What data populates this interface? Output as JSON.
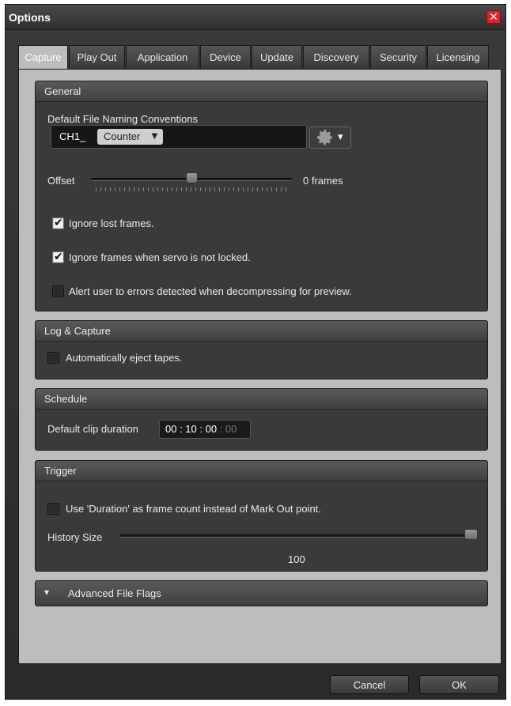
{
  "window": {
    "title": "Options",
    "close_glyph": "✕"
  },
  "tabs": [
    "Capture",
    "Play Out",
    "Application",
    "Device",
    "Update",
    "Discovery",
    "Security",
    "Licensing"
  ],
  "general": {
    "title": "General",
    "naming_label": "Default File Naming Conventions",
    "prefix": "CH1_",
    "token": "Counter",
    "token_arrow": "▼",
    "gear_arrow": "▾",
    "offset_label": "Offset",
    "offset_value": "0 frames",
    "offset_level": 0.5,
    "ignore_lost": {
      "label": "Ignore lost frames.",
      "checked": true
    },
    "ignore_servo": {
      "label": "Ignore frames when servo is not locked.",
      "checked": true
    },
    "alert_errors": {
      "label": "Alert user to errors detected when decompressing for preview.",
      "checked": false
    }
  },
  "log_capture": {
    "title": "Log & Capture",
    "eject": {
      "label": "Automatically eject tapes.",
      "checked": false
    }
  },
  "schedule": {
    "title": "Schedule",
    "duration_label": "Default clip duration",
    "duration_main": "00 : 10 : 00",
    "duration_frames": " : 00"
  },
  "trigger": {
    "title": "Trigger",
    "duration_count": {
      "label": "Use 'Duration' as frame count instead of Mark Out point.",
      "checked": false
    },
    "history_label": "History Size",
    "history_value": "100",
    "history_level": 1.0
  },
  "advanced": {
    "title": "Advanced File Flags",
    "arrow": "▾"
  },
  "buttons": {
    "cancel": "Cancel",
    "ok": "OK"
  },
  "colors": {
    "accent_close": "#d8242a",
    "panel": "#3a3a3a",
    "content_bg": "#bdbdbd"
  }
}
